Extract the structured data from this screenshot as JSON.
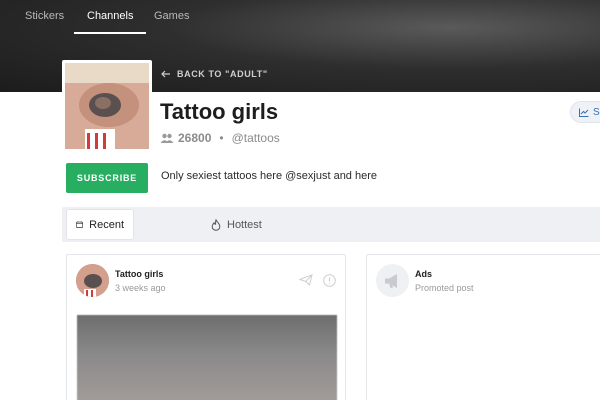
{
  "topnav": {
    "tabs": [
      {
        "label": "Stickers",
        "active": false
      },
      {
        "label": "Channels",
        "active": true
      },
      {
        "label": "Games",
        "active": false
      }
    ]
  },
  "back_link": {
    "label": "BACK TO \"ADULT\"",
    "icon": "arrow-left-icon"
  },
  "channel": {
    "title": "Tattoo girls",
    "members_count": "26800",
    "handle": "@tattoos",
    "description": "Only sexiest tattoos here @sexjust and here",
    "subscribe_label": "SUBSCRIBE",
    "stats_label": "S"
  },
  "filters": [
    {
      "label": "Recent",
      "icon": "calendar-icon",
      "active": true
    },
    {
      "label": "Hottest",
      "icon": "flame-icon",
      "active": false
    }
  ],
  "post": {
    "author": "Tattoo girls",
    "time": "3 weeks ago"
  },
  "ads": {
    "title": "Ads",
    "subtitle": "Promoted post",
    "icon": "megaphone-icon"
  },
  "colors": {
    "subscribe": "#27ae60",
    "hero_dark": "#1c1c1c"
  }
}
